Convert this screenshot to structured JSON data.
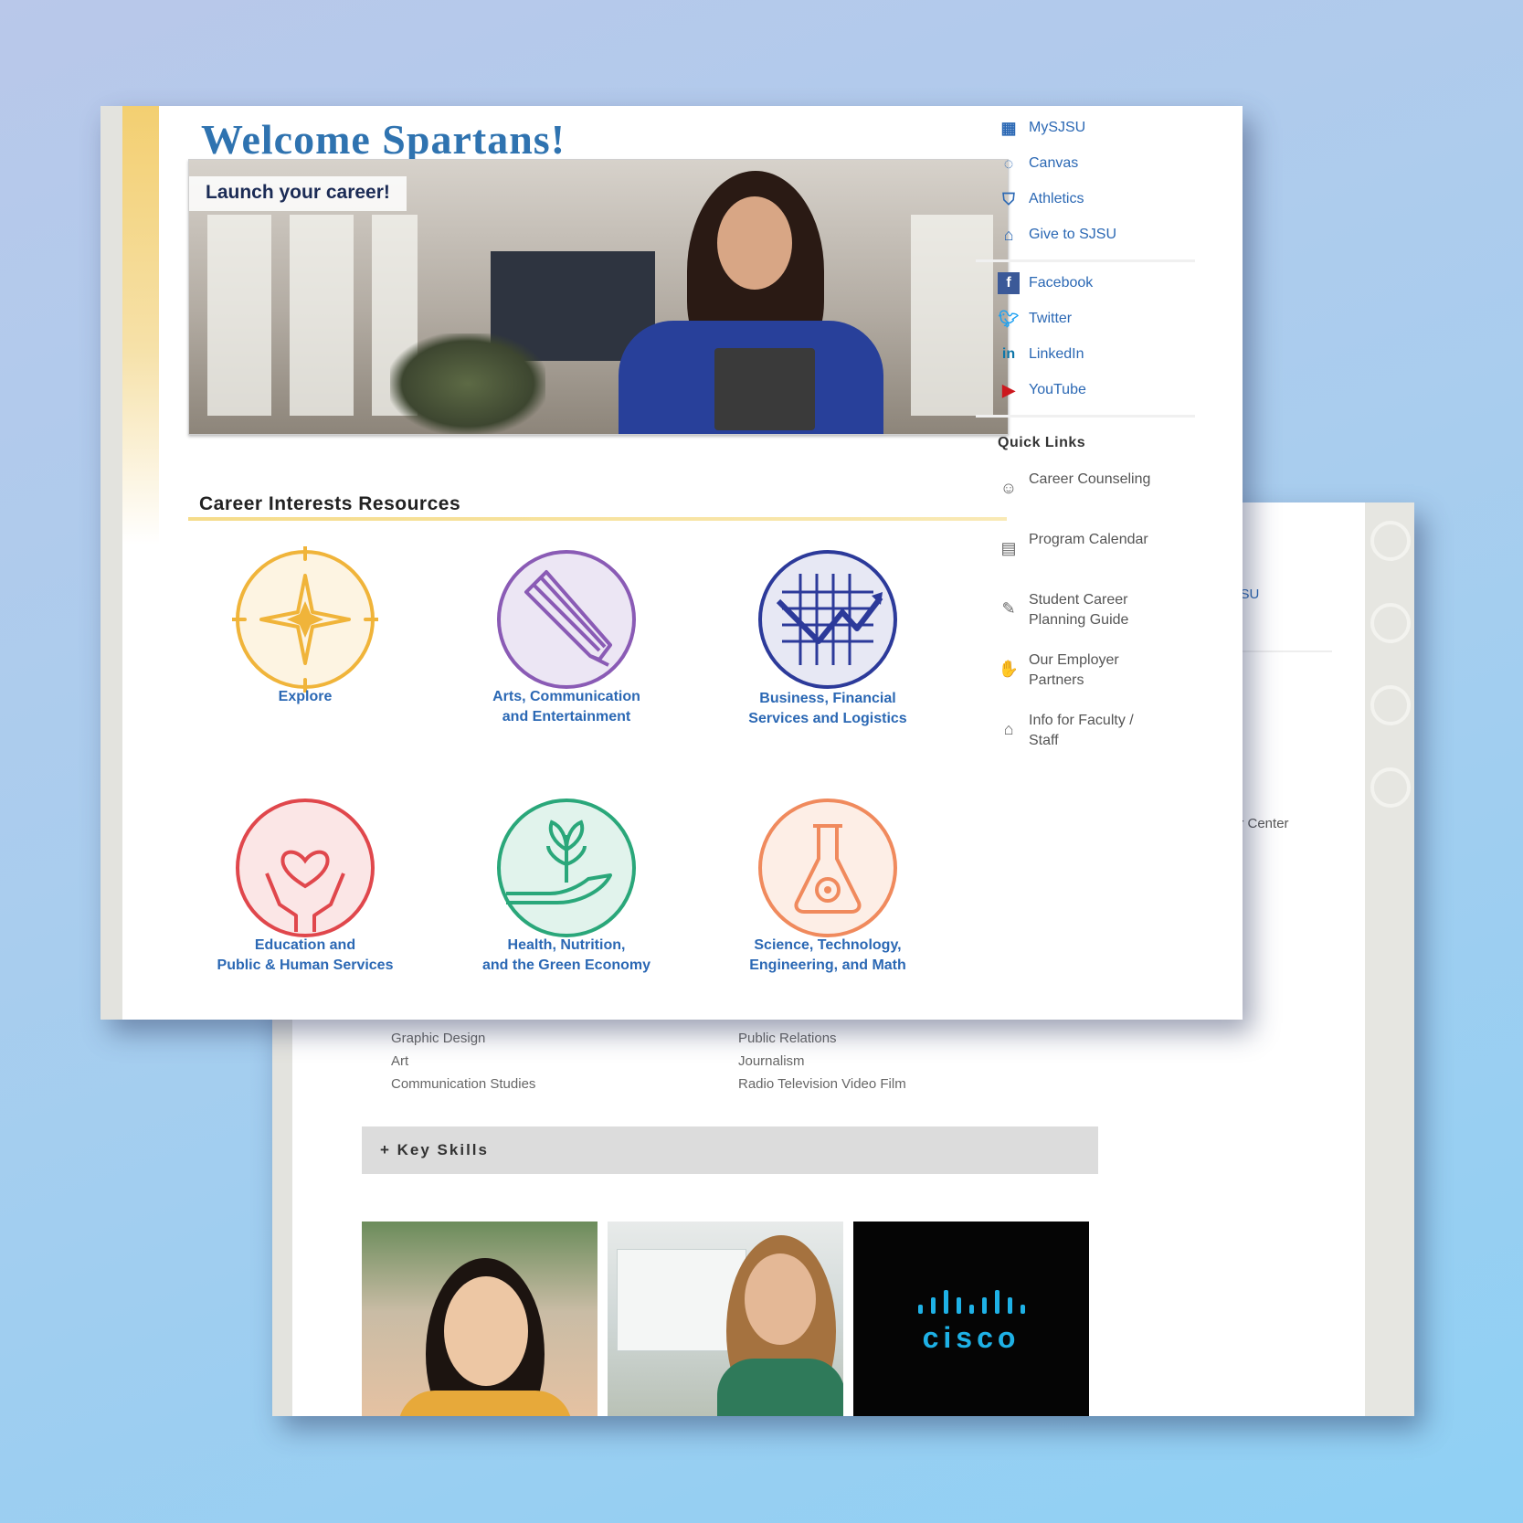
{
  "front": {
    "welcome_title": "Welcome Spartans!",
    "hero_caption": "Launch your career!",
    "section_title": "Career Interests Resources",
    "career_interests": [
      {
        "label": "Explore",
        "icon": "compass-star-icon",
        "color": "#f0b43a"
      },
      {
        "label": "Arts, Communication\nand Entertainment",
        "icon": "pencil-icon",
        "color": "#8a5bb5"
      },
      {
        "label": "Business, Financial\nServices and Logistics",
        "icon": "growth-chart-icon",
        "color": "#2c3a9a"
      },
      {
        "label": "Education and\nPublic & Human Services",
        "icon": "heart-hands-icon",
        "color": "#e0474c"
      },
      {
        "label": "Health, Nutrition,\nand the Green Economy",
        "icon": "sprout-hand-icon",
        "color": "#2aa77a"
      },
      {
        "label": "Science, Technology,\nEngineering, and Math",
        "icon": "flask-icon",
        "color": "#f08a5d"
      }
    ],
    "sidebar_links": [
      {
        "label": "MySJSU",
        "icon": "mysjsu-icon"
      },
      {
        "label": "Canvas",
        "icon": "canvas-icon"
      },
      {
        "label": "Athletics",
        "icon": "athletics-icon"
      },
      {
        "label": "Give to SJSU",
        "icon": "give-icon"
      }
    ],
    "social_links": [
      {
        "label": "Facebook",
        "icon": "facebook-icon",
        "color": "#3b5998"
      },
      {
        "label": "Twitter",
        "icon": "twitter-icon",
        "color": "#1da1f2"
      },
      {
        "label": "LinkedIn",
        "icon": "linkedin-icon",
        "color": "#0e76a8"
      },
      {
        "label": "YouTube",
        "icon": "youtube-icon",
        "color": "#cc181e"
      }
    ],
    "quick_links_title": "Quick Links",
    "quick_links": [
      {
        "label": "Career Counseling",
        "icon": "counseling-icon"
      },
      {
        "label": "Program Calendar",
        "icon": "calendar-icon"
      },
      {
        "label": "Student Career Planning Guide",
        "icon": "guide-icon"
      },
      {
        "label": "Our Employer Partners",
        "icon": "handshake-icon"
      },
      {
        "label": "Info for Faculty / Staff",
        "icon": "briefcase-icon"
      }
    ]
  },
  "back": {
    "fragment_link": "JSU",
    "fragment_text": "er Center",
    "majors_left": [
      "Graphic Design",
      "Art",
      "Communication Studies"
    ],
    "majors_right": [
      "Public Relations",
      "Journalism",
      "Radio Television Video Film"
    ],
    "key_skills_label": "+ Key Skills",
    "employer_logo": "cisco"
  },
  "colors": {
    "link_blue": "#2b68b4",
    "title_blue": "#2f73b0",
    "gold": "#f3cf71"
  }
}
